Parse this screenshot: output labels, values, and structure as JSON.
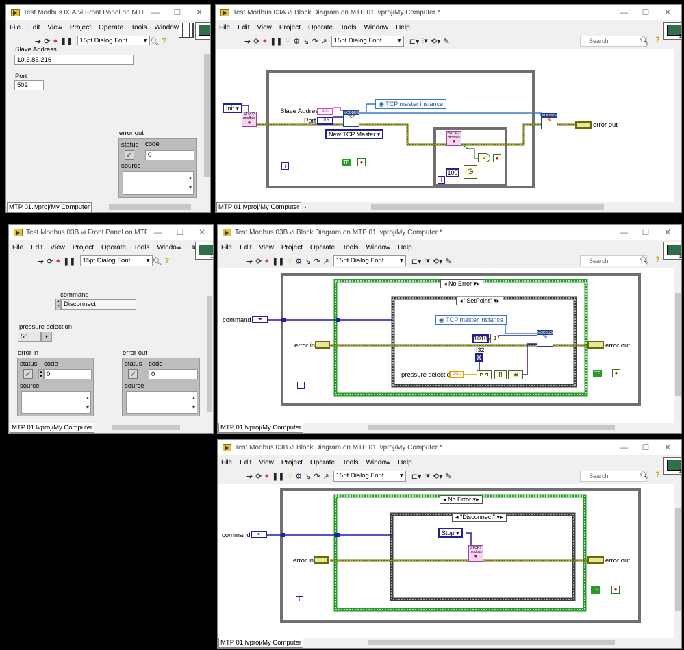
{
  "menus": [
    "File",
    "Edit",
    "View",
    "Project",
    "Operate",
    "Tools",
    "Window",
    "Help"
  ],
  "menus_truncated": [
    "File",
    "Edit",
    "View",
    "Project",
    "Operate",
    "Tools",
    "Window",
    "Hel"
  ],
  "toolbar": {
    "font": "15pt Dialog Font",
    "search_placeholder": "Search"
  },
  "status": {
    "project": "MTP 01.lvproj/My Computer"
  },
  "win1": {
    "title": "Test Modbus 03A.vi Front Panel on MTP 01....",
    "slave_address_label": "Slave Address",
    "slave_address_value": "10.3.85.216",
    "port_label": "Port",
    "port_value": "502",
    "error_out_label": "error out",
    "status_label": "status",
    "code_label": "code",
    "code_value": "0",
    "source_label": "source"
  },
  "win2": {
    "title": "Test Modbus 03A.vi Block Diagram on MTP 01.lvproj/My Computer *",
    "init_label": "Init",
    "slave_address_label": "Slave Address",
    "port_label": "Port",
    "abc": "abc",
    "u16": "U16",
    "tcp_instance": "TCP master instance",
    "new_tcp_master": "New TCP Master",
    "wait_const": "100",
    "error_out": "error out",
    "modbus": "MODBUS",
    "tcp": "TCP",
    "stop": "STOP?",
    "modbus_small": "modbus",
    "loop_i": "i",
    "tf": "TF"
  },
  "win3": {
    "title": "Test Modbus 03B.vi Front Panel on MTP 01....",
    "command_label": "command",
    "command_value": "Disconnect",
    "pressure_label": "pressure selection",
    "pressure_value": "58",
    "error_in_label": "error in",
    "error_out_label": "error out",
    "status_label": "status",
    "code_label": "code",
    "code_value": "0",
    "source_label": "source"
  },
  "win4": {
    "title": "Test Modbus 03B.vi Block Diagram on MTP 01.lvproj/My Computer *",
    "command": "command",
    "error_in": "error in",
    "error_out": "error out",
    "case_outer": "No Error",
    "case_inner": "\"SetPoint\"",
    "tcp_instance": "TCP master instance",
    "const_1010": "1010",
    "i32": "I32",
    "zero": "0",
    "pressure_selection": "pressure selection",
    "sgl": "SGL",
    "modbus": "MODBUS",
    "loop_i": "i",
    "tf": "TF"
  },
  "win5": {
    "title": "Test Modbus 03B.vi Block Diagram on MTP 01.lvproj/My Computer *",
    "command": "command",
    "error_in": "error in",
    "error_out": "error out",
    "case_outer": "No Error",
    "case_inner": "\"Disconnect\"",
    "stop_const": "Stop",
    "stop": "STOP?",
    "modbus_small": "modbus",
    "loop_i": "i",
    "tf": "TF"
  },
  "colors": {
    "error_wire": "#6b6b00",
    "error_wire_fill": "#e6e6a0",
    "class_wire": "#3a78c8",
    "enum_wire": "#1f1f9f",
    "case_green": "#2a9a2a",
    "loop_gray": "#6e6e6e",
    "string_pink": "#e040c0"
  },
  "icons": {
    "run": "run-arrow-icon",
    "run_continuous": "run-continuous-icon",
    "abort": "abort-icon",
    "pause": "pause-icon",
    "highlight": "highlight-execution-icon",
    "retain": "retain-wire-values-icon",
    "step_into": "step-into-icon",
    "step_over": "step-over-icon",
    "step_out": "step-out-icon",
    "align": "align-objects-icon",
    "distribute": "distribute-objects-icon",
    "reorder": "reorder-icon",
    "cleanup": "cleanup-diagram-icon",
    "search": "search-icon",
    "help": "context-help-icon"
  }
}
